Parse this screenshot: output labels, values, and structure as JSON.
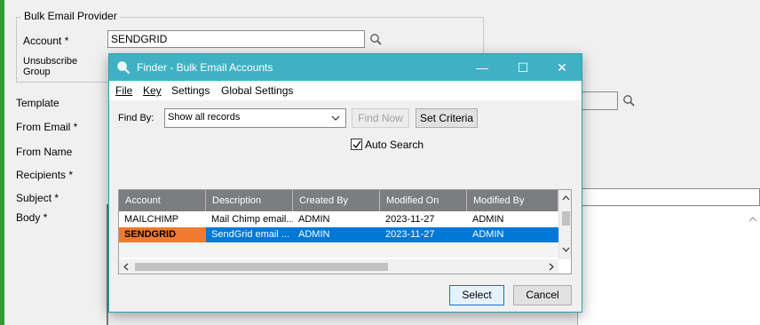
{
  "background_form": {
    "group_title": "Bulk Email Provider",
    "account_label": "Account *",
    "account_value": "SENDGRID",
    "unsubscribe_label_line1": "Unsubscribe",
    "unsubscribe_label_line2": "Group",
    "template_label": "Template",
    "from_email_label": "From Email *",
    "from_name_label": "From Name",
    "recipients_label": "Recipients *",
    "subject_label": "Subject *",
    "body_label": "Body *"
  },
  "dialog": {
    "title": "Finder - Bulk Email Accounts",
    "minimize_glyph": "—",
    "maximize_glyph": "☐",
    "close_glyph": "✕",
    "menu": {
      "file": "File",
      "key": "Key",
      "settings": "Settings",
      "global_settings": "Global Settings"
    },
    "find_by_label": "Find By:",
    "find_by_value": "Show all records",
    "find_now_label": "Find Now",
    "set_criteria_label": "Set Criteria",
    "auto_search_label": "Auto Search",
    "auto_search_checked": true,
    "grid": {
      "columns": [
        "Account",
        "Description",
        "Created By",
        "Modified On",
        "Modified By"
      ],
      "rows": [
        [
          "MAILCHIMP",
          "Mail Chimp email...",
          "ADMIN",
          "2023-11-27",
          "ADMIN"
        ],
        [
          "SENDGRID",
          "SendGrid email ...",
          "ADMIN",
          "2023-11-27",
          "ADMIN"
        ]
      ],
      "selected_row": 1
    },
    "select_label": "Select",
    "cancel_label": "Cancel"
  },
  "colors": {
    "titlebar": "#40b1c4",
    "selection": "#0078d7",
    "account_highlight": "#ef7a30",
    "side_bar": "#2e9b2e"
  }
}
